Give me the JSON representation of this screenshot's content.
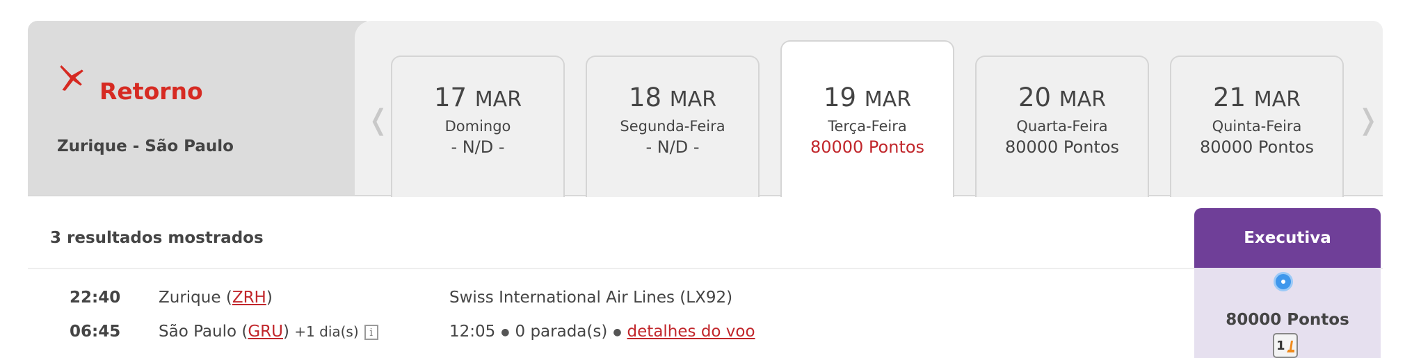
{
  "header": {
    "title": "Retorno",
    "route": "Zurique - São Paulo",
    "prev_arrow": "❬",
    "next_arrow": "❭",
    "accent_color": "#d62a22"
  },
  "dates": [
    {
      "day": "17",
      "month": "MAR",
      "weekday": "Domingo",
      "points": "- N/D -"
    },
    {
      "day": "18",
      "month": "MAR",
      "weekday": "Segunda-Feira",
      "points": "- N/D -"
    },
    {
      "day": "19",
      "month": "MAR",
      "weekday": "Terça-Feira",
      "points": "80000 Pontos"
    },
    {
      "day": "20",
      "month": "MAR",
      "weekday": "Quarta-Feira",
      "points": "80000 Pontos"
    },
    {
      "day": "21",
      "month": "MAR",
      "weekday": "Quinta-Feira",
      "points": "80000 Pontos"
    }
  ],
  "results": {
    "count_label": "3 resultados mostrados",
    "cabin_label": "Executiva",
    "cabin_color": "#6f3f98"
  },
  "flight": {
    "depart_time": "22:40",
    "arrive_time": "06:45",
    "origin_city": "Zurique",
    "origin_code": "ZRH",
    "dest_city": "São Paulo",
    "dest_code": "GRU",
    "next_day": "+1 dia(s)",
    "info_icon": "i",
    "airline": "Swiss International Air Lines (LX92)",
    "duration": "12:05",
    "stops": "0 parada(s)",
    "details_link": "detalhes do voo",
    "price": "80000 Pontos",
    "seat_badge": "1"
  }
}
